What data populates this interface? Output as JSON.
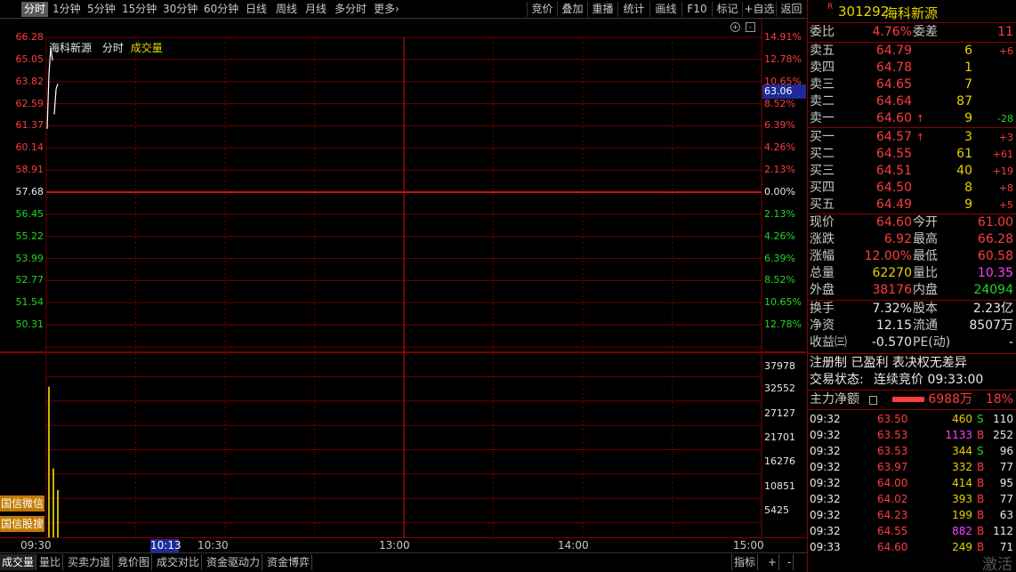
{
  "toolbar": {
    "periods": [
      "分时",
      "1分钟",
      "5分钟",
      "15分钟",
      "30分钟",
      "60分钟",
      "日线",
      "周线",
      "月线",
      "多分时",
      "更多"
    ],
    "more_arrow": "›",
    "buttons": [
      "竞价",
      "叠加",
      "重播",
      "统计",
      "画线",
      "F10",
      "标记",
      "+自选",
      "返回"
    ]
  },
  "chart": {
    "legend_name": "海科新源",
    "legend_mode": "分时",
    "legend_indicator": "成交量",
    "price_ticks": [
      "66.28",
      "65.05",
      "63.82",
      "62.59",
      "61.37",
      "60.14",
      "58.91",
      "57.68",
      "56.45",
      "55.22",
      "53.99",
      "52.77",
      "51.54",
      "50.31"
    ],
    "pct_ticks": [
      "14.91%",
      "12.78%",
      "10.65%",
      "8.52%",
      "6.39%",
      "4.26%",
      "2.13%",
      "0.00%",
      "2.13%",
      "4.26%",
      "6.39%",
      "8.52%",
      "10.65%",
      "12.78%"
    ],
    "volume_ticks": [
      "37978",
      "32552",
      "27127",
      "21701",
      "16276",
      "10851",
      "5425"
    ],
    "crosshair_price": "63.06",
    "side_buttons": [
      "国信微信",
      "国信股搜"
    ],
    "time_labels": [
      "09:30",
      "10:30",
      "13:00",
      "14:00",
      "15:00"
    ],
    "time_marker": "10:13"
  },
  "chart_data": {
    "type": "line",
    "prev_close": 57.68,
    "x": [
      "09:30",
      "09:30",
      "09:31",
      "09:31",
      "09:32",
      "09:32",
      "09:33"
    ],
    "series": [
      {
        "values": [
          61.2,
          64.2,
          65.7,
          65.0,
          62.0,
          63.4,
          63.7
        ]
      }
    ],
    "volume": [
      35000,
      16000,
      11000
    ],
    "ylim": [
      50.31,
      66.28
    ],
    "volume_ylim": [
      0,
      43000
    ],
    "x_range": [
      "09:30",
      "15:00"
    ]
  },
  "panel": {
    "code": "301292",
    "name": "海科新源",
    "r_icon": "R",
    "weibi_label": "委比",
    "weibi": "4.76%",
    "weicha_label": "委差",
    "weicha": "11",
    "asks": [
      {
        "label": "卖五",
        "price": "64.79",
        "vol": "6",
        "chg": "+6"
      },
      {
        "label": "卖四",
        "price": "64.78",
        "vol": "1",
        "chg": ""
      },
      {
        "label": "卖三",
        "price": "64.65",
        "vol": "7",
        "chg": ""
      },
      {
        "label": "卖二",
        "price": "64.64",
        "vol": "87",
        "chg": ""
      },
      {
        "label": "卖一",
        "price": "64.60",
        "vol": "9",
        "chg": "-28",
        "arrow": "↑"
      }
    ],
    "bids": [
      {
        "label": "买一",
        "price": "64.57",
        "vol": "3",
        "chg": "+3",
        "arrow": "↑"
      },
      {
        "label": "买二",
        "price": "64.55",
        "vol": "61",
        "chg": "+61"
      },
      {
        "label": "买三",
        "price": "64.51",
        "vol": "40",
        "chg": "+19"
      },
      {
        "label": "买四",
        "price": "64.50",
        "vol": "8",
        "chg": "+8"
      },
      {
        "label": "买五",
        "price": "64.49",
        "vol": "9",
        "chg": "+5"
      }
    ],
    "stats": [
      {
        "l1": "现价",
        "v1": "64.60",
        "c1": "red",
        "l2": "今开",
        "v2": "61.00",
        "c2": "red"
      },
      {
        "l1": "涨跌",
        "v1": "6.92",
        "c1": "red",
        "l2": "最高",
        "v2": "66.28",
        "c2": "red"
      },
      {
        "l1": "涨幅",
        "v1": "12.00%",
        "c1": "red",
        "l2": "最低",
        "v2": "60.58",
        "c2": "red"
      },
      {
        "l1": "总量",
        "v1": "62270",
        "c1": "yellow",
        "l2": "量比",
        "v2": "10.35",
        "c2": "magenta"
      },
      {
        "l1": "外盘",
        "v1": "38176",
        "c1": "red",
        "l2": "内盘",
        "v2": "24094",
        "c2": "green"
      }
    ],
    "stats2": [
      {
        "l1": "换手",
        "v1": "7.32%",
        "l2": "股本",
        "v2": "2.23亿"
      },
      {
        "l1": "净资",
        "v1": "12.15",
        "l2": "流通",
        "v2": "8507万"
      },
      {
        "l1": "收益㈢",
        "v1": "-0.570",
        "l2": "PE(动)",
        "v2": "-"
      }
    ],
    "tags": "注册制 已盈利 表决权无差异",
    "trade_status_label": "交易状态:",
    "trade_status": "连续竞价 09:33:00",
    "main_flow_label": "主力净额",
    "main_flow_value": "6988万",
    "main_flow_pct": "18%",
    "trades": [
      {
        "time": "09:32",
        "price": "63.50",
        "vol": "460",
        "side": "S",
        "n": "110",
        "vc": "yellow"
      },
      {
        "time": "09:32",
        "price": "63.53",
        "vol": "1133",
        "side": "B",
        "n": "252",
        "vc": "magenta"
      },
      {
        "time": "09:32",
        "price": "63.53",
        "vol": "344",
        "side": "S",
        "n": "96",
        "vc": "yellow"
      },
      {
        "time": "09:32",
        "price": "63.97",
        "vol": "332",
        "side": "B",
        "n": "77",
        "vc": "yellow"
      },
      {
        "time": "09:32",
        "price": "64.00",
        "vol": "414",
        "side": "B",
        "n": "95",
        "vc": "yellow"
      },
      {
        "time": "09:32",
        "price": "64.02",
        "vol": "393",
        "side": "B",
        "n": "77",
        "vc": "yellow"
      },
      {
        "time": "09:32",
        "price": "64.23",
        "vol": "199",
        "side": "B",
        "n": "63",
        "vc": "yellow"
      },
      {
        "time": "09:32",
        "price": "64.55",
        "vol": "882",
        "side": "B",
        "n": "112",
        "vc": "magenta"
      },
      {
        "time": "09:33",
        "price": "64.60",
        "vol": "249",
        "side": "B",
        "n": "71",
        "vc": "yellow"
      }
    ]
  },
  "bottom_tabs": [
    "成交量",
    "量比",
    "买卖力道",
    "竞价图",
    "成交对比",
    "资金驱动力",
    "资金博弈"
  ],
  "bottom_right": {
    "indicator": "指标",
    "plus": "+",
    "minus": "-"
  },
  "watermark": "激活",
  "colors": {
    "up": "#ff3c3c",
    "down": "#22d622",
    "grid": "#8b0000",
    "price_line": "#ffffff",
    "volume": "#c8b400"
  }
}
